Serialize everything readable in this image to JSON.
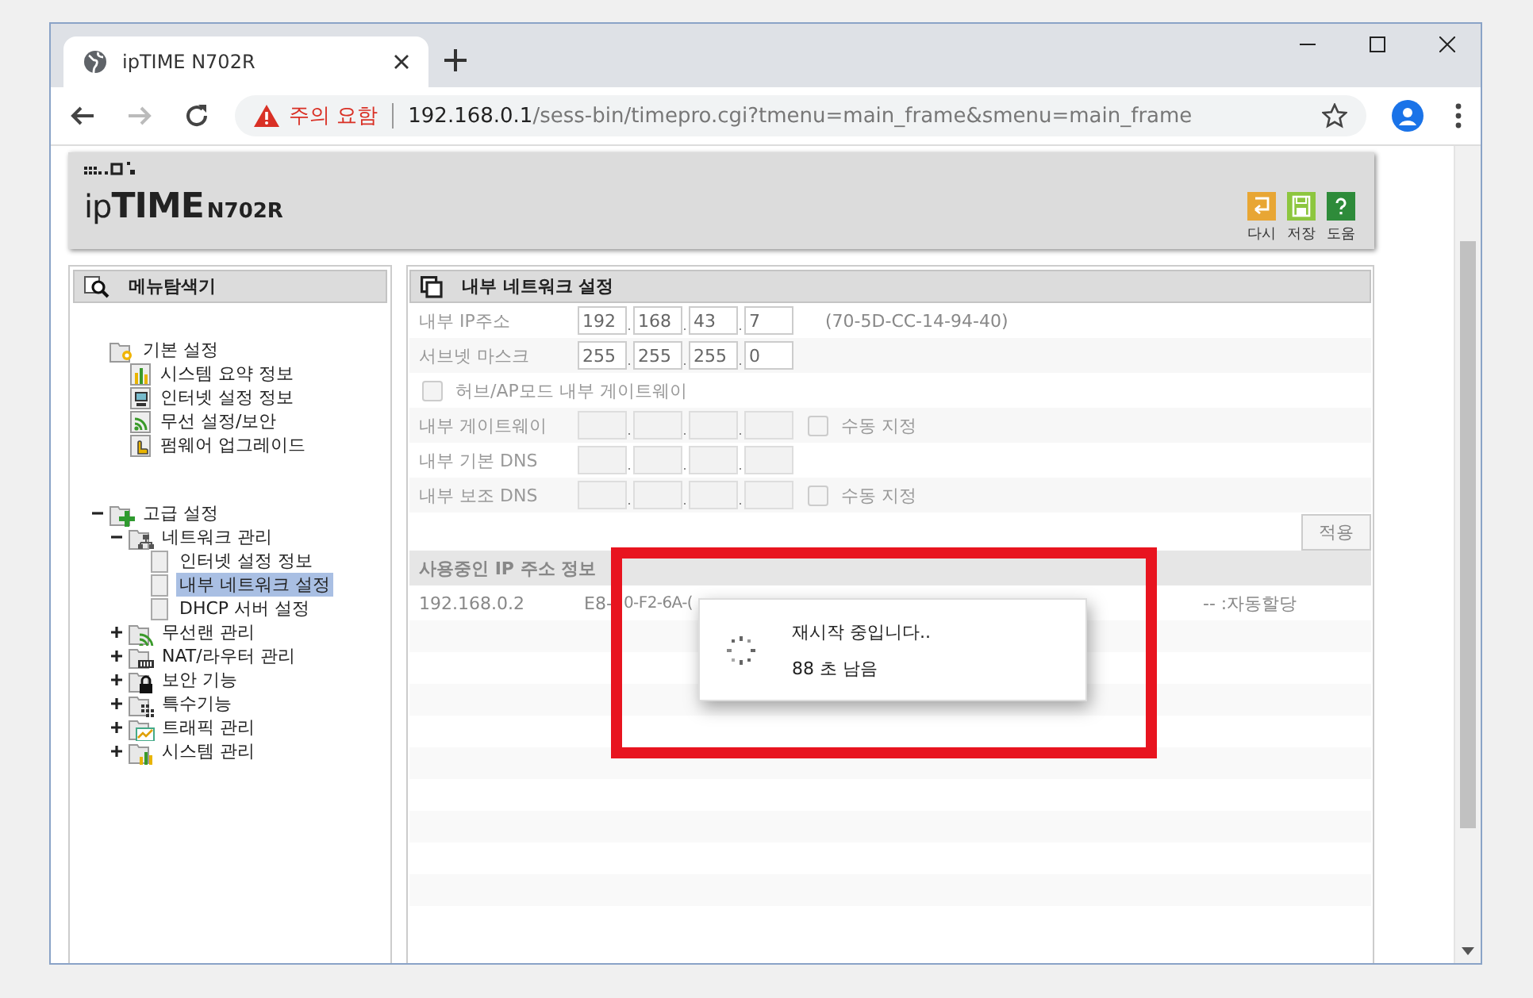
{
  "browser": {
    "tab_title": "ipTIME N702R",
    "security_warning": "주의 요함",
    "url_host": "192.168.0.1",
    "url_path": "/sess-bin/timepro.cgi?tmenu=main_frame&smenu=main_frame",
    "forward_disabled": true
  },
  "header": {
    "logo": "ip**TIME**",
    "model": "N702R",
    "actions": [
      {
        "label": "다시",
        "kind": "back"
      },
      {
        "label": "저장",
        "kind": "save"
      },
      {
        "label": "도움",
        "kind": "help"
      }
    ]
  },
  "menu": {
    "title": "메뉴탐색기",
    "tree": [
      {
        "label": "기본 설정",
        "kind": "folder-flower",
        "selected": false,
        "children": [
          {
            "label": "시스템 요약 정보",
            "kind": "chart",
            "selected": false
          },
          {
            "label": "인터넷 설정 정보",
            "kind": "monitor",
            "selected": false
          },
          {
            "label": "무선 설정/보안",
            "kind": "wifi",
            "selected": false
          },
          {
            "label": "펌웨어 업그레이드",
            "kind": "upgrade",
            "selected": false
          }
        ]
      },
      {
        "label": "고급 설정",
        "kind": "folder-cross",
        "selected": false,
        "expanded": true,
        "children": [
          {
            "label": "네트워크 관리",
            "kind": "folder-network",
            "selected": false,
            "expanded": true,
            "children": [
              {
                "label": "인터넷 설정 정보",
                "kind": "page",
                "selected": false
              },
              {
                "label": "내부 네트워크 설정",
                "kind": "page",
                "selected": true
              },
              {
                "label": "DHCP 서버 설정",
                "kind": "page",
                "selected": false
              }
            ]
          },
          {
            "label": "무선랜 관리",
            "kind": "folder-wifi",
            "selected": false,
            "expanded": false
          },
          {
            "label": "NAT/라우터 관리",
            "kind": "folder-router",
            "selected": false,
            "expanded": false
          },
          {
            "label": "보안 기능",
            "kind": "folder-lock",
            "selected": false,
            "expanded": false
          },
          {
            "label": "특수기능",
            "kind": "folder-grid",
            "selected": false,
            "expanded": false
          },
          {
            "label": "트래픽 관리",
            "kind": "folder-graph",
            "selected": false,
            "expanded": false
          },
          {
            "label": "시스템 관리",
            "kind": "folder-bars",
            "selected": false,
            "expanded": false
          }
        ]
      }
    ]
  },
  "settings": {
    "title": "내부 네트워크 설정",
    "rows": [
      {
        "kind": "ip",
        "label": "내부 IP주소",
        "disabled": false,
        "octets": [
          "192",
          "168",
          "43",
          "7"
        ],
        "note": "(70-5D-CC-14-94-40)"
      },
      {
        "kind": "ip",
        "label": "서브넷 마스크",
        "disabled": false,
        "octets": [
          "255",
          "255",
          "255",
          "0"
        ]
      },
      {
        "kind": "checkbox",
        "label": "허브/AP모드 내부 게이트웨이",
        "checked": false
      },
      {
        "kind": "ip",
        "label": "내부 게이트웨이",
        "disabled": true,
        "manual": {
          "label": "수동 지정",
          "checked": false
        }
      },
      {
        "kind": "ip",
        "label": "내부 기본 DNS",
        "disabled": true
      },
      {
        "kind": "ip",
        "label": "내부 보조 DNS",
        "disabled": true,
        "manual": {
          "label": "수동 지정",
          "checked": false
        }
      }
    ],
    "apply_button": "적용"
  },
  "ip_usage": {
    "title": "사용중인 IP 주소 정보",
    "rows": [
      {
        "ip": "192.168.0.2",
        "mac_parts": [
          "E8-",
          "0-F2-6A-("
        ],
        "type": "-- :자동할당"
      }
    ]
  },
  "dialog": {
    "message": "재시작 중입니다..",
    "remaining": "88 초 남음"
  }
}
